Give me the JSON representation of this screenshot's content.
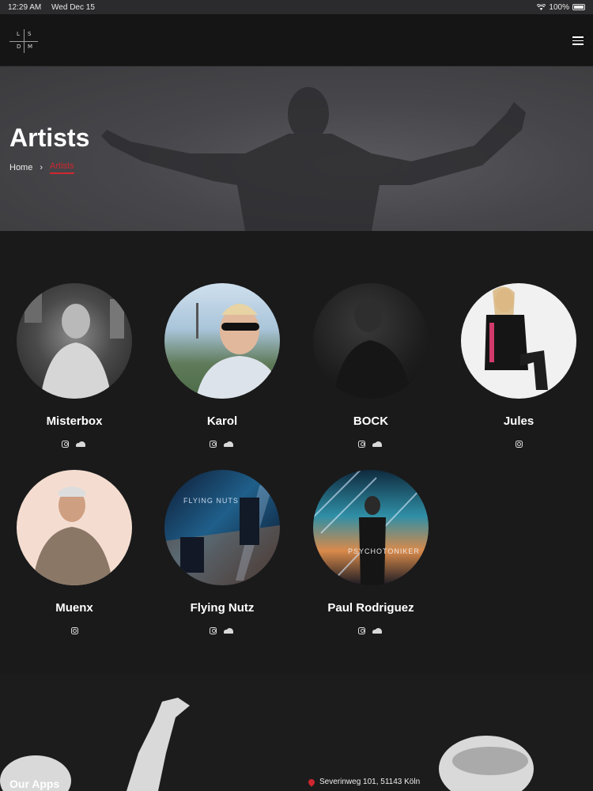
{
  "status": {
    "time": "12:29 AM",
    "date": "Wed Dec 15",
    "battery": "100%"
  },
  "logo": {
    "letters": [
      "L",
      "S",
      "D",
      "M"
    ]
  },
  "hero": {
    "title": "Artists",
    "breadcrumb_home": "Home",
    "breadcrumb_current": "Artists"
  },
  "artists": [
    {
      "name": "Misterbox",
      "instagram": true,
      "soundcloud": true
    },
    {
      "name": "Karol",
      "instagram": true,
      "soundcloud": true
    },
    {
      "name": "BOCK",
      "instagram": true,
      "soundcloud": true
    },
    {
      "name": "Jules",
      "instagram": true,
      "soundcloud": false
    },
    {
      "name": "Muenx",
      "instagram": true,
      "soundcloud": false
    },
    {
      "name": "Flying Nutz",
      "instagram": true,
      "soundcloud": true,
      "photo_caption": "FLYING NUTS"
    },
    {
      "name": "Paul Rodriguez",
      "instagram": true,
      "soundcloud": true,
      "photo_caption": "PSYCHOTONIKER"
    }
  ],
  "footer": {
    "apps_heading": "Our Apps",
    "address": "Severinweg 101, 51143 Köln"
  },
  "colors": {
    "accent": "#d0262e",
    "background": "#1a1a1b",
    "navbar": "#151516"
  }
}
